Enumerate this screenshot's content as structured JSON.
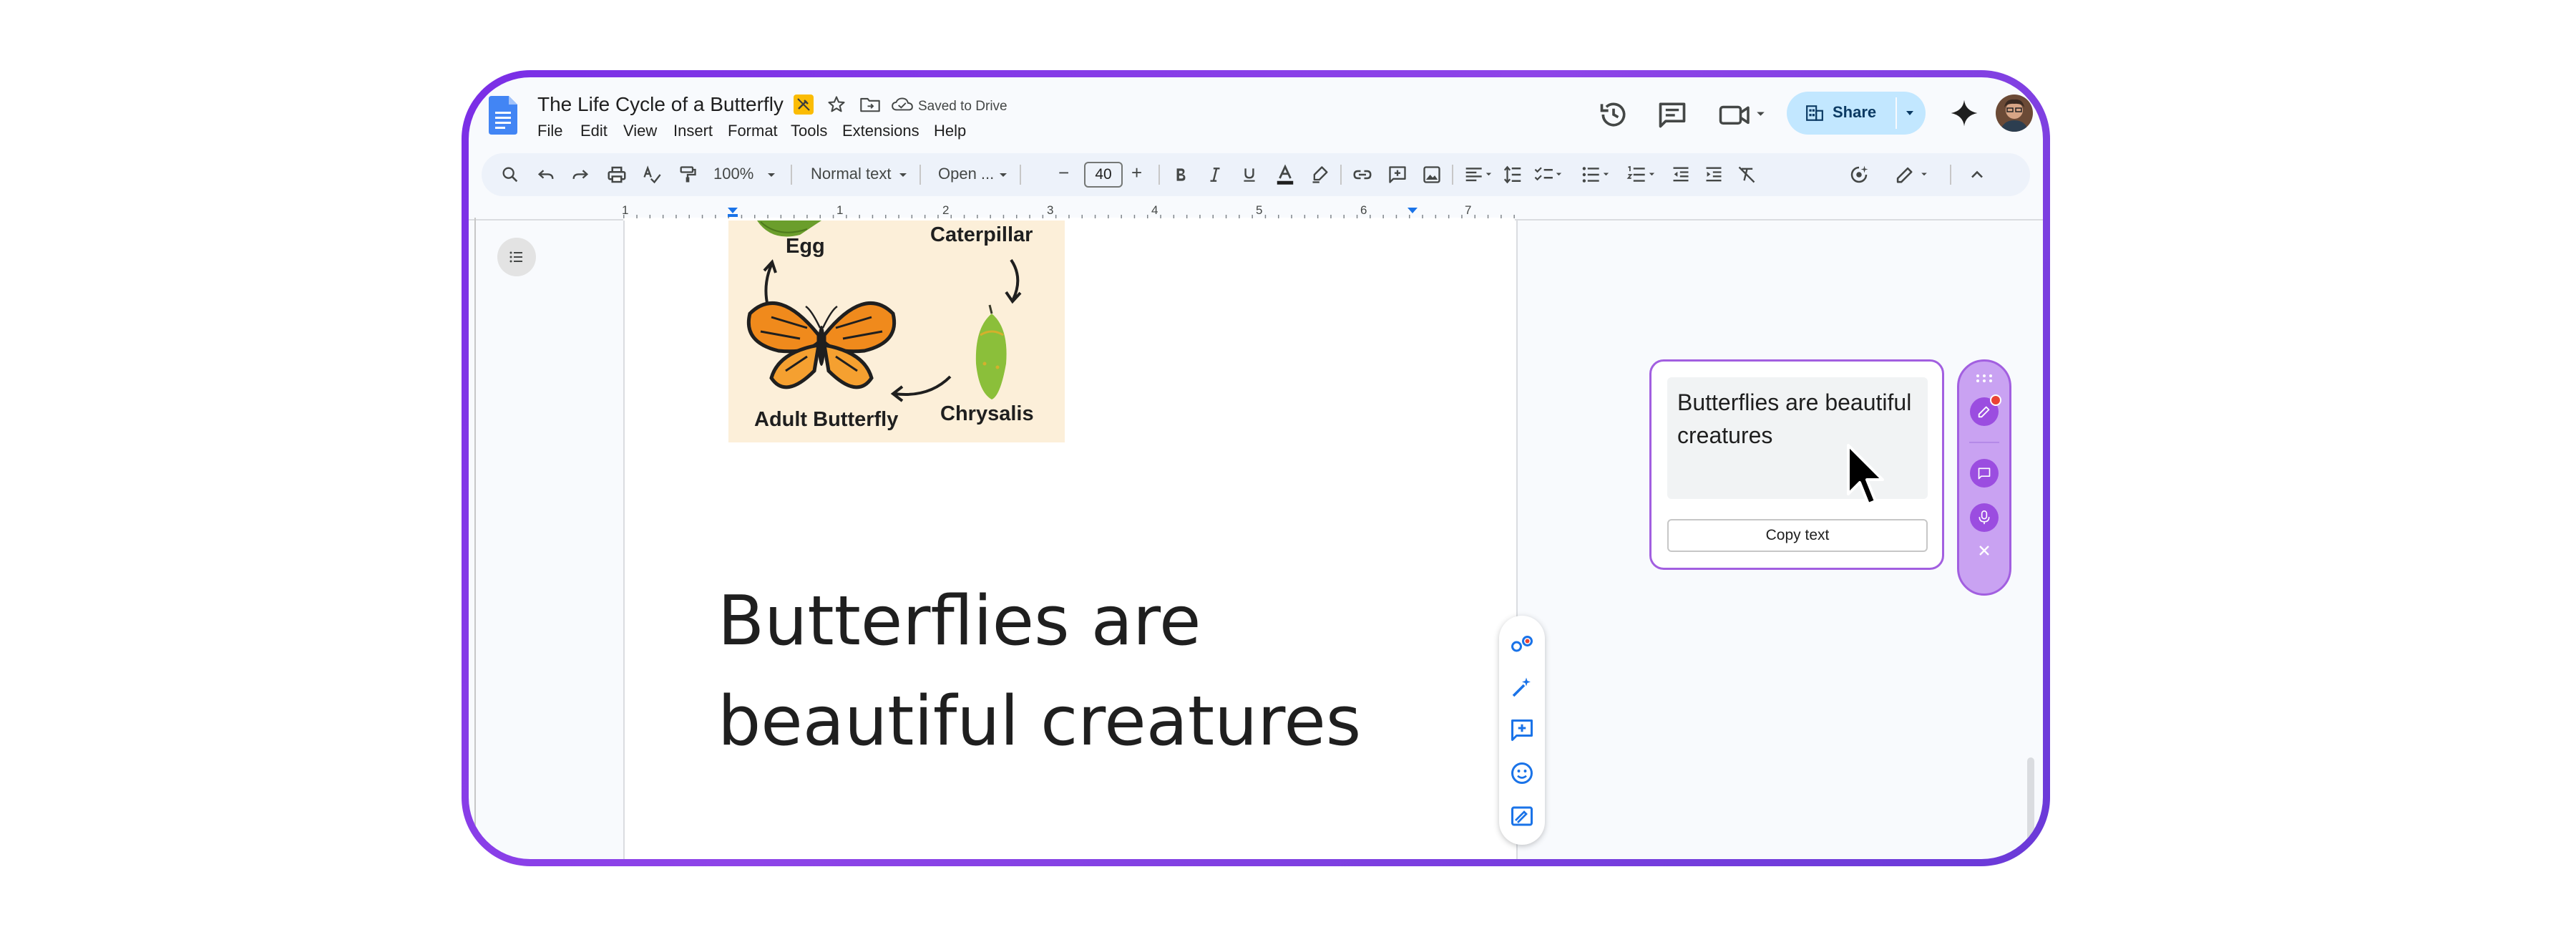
{
  "document": {
    "title": "The Life Cycle of a Butterfly",
    "save_status": "Saved to Drive",
    "heading_line1": "Butterflies are",
    "heading_line2": "beautiful creatures"
  },
  "menu": [
    "File",
    "Edit",
    "View",
    "Insert",
    "Format",
    "Tools",
    "Extensions",
    "Help"
  ],
  "toolbar": {
    "zoom": "100%",
    "style": "Normal text",
    "font": "Open ...",
    "font_size": "40",
    "minus": "−",
    "plus": "+"
  },
  "header": {
    "share_label": "Share"
  },
  "ruler": {
    "numbers": [
      "1",
      "1",
      "2",
      "3",
      "4",
      "5",
      "6",
      "7"
    ]
  },
  "illustration": {
    "labels": [
      "Egg",
      "Caterpillar",
      "Adult Butterfly",
      "Chrysalis"
    ]
  },
  "extension_panel": {
    "text": "Butterflies are beautiful creatures",
    "copy_label": "Copy text"
  },
  "colors": {
    "frame": "#7a2ee6",
    "accent_blue": "#1a73e8",
    "share_bg": "#c2e7ff",
    "extension_purple": "#9b4de0"
  },
  "icons": {
    "header": [
      "version-history-icon",
      "comments-icon",
      "meet-icon",
      "gemini-icon"
    ],
    "toolbar": [
      "search-icon",
      "undo-icon",
      "redo-icon",
      "print-icon",
      "spellcheck-icon",
      "paint-format-icon",
      "bold-icon",
      "italic-icon",
      "underline-icon",
      "text-color-icon",
      "highlight-icon",
      "link-icon",
      "add-comment-icon",
      "insert-image-icon",
      "align-icon",
      "line-spacing-icon",
      "checklist-icon",
      "bulleted-list-icon",
      "numbered-list-icon",
      "decrease-indent-icon",
      "increase-indent-icon",
      "clear-formatting-icon",
      "ai-assist-icon",
      "editing-mode-icon",
      "collapse-icon"
    ],
    "floating": [
      "smart-chips-icon",
      "ai-write-icon",
      "add-comment-icon",
      "emoji-icon",
      "suggest-edits-icon"
    ]
  }
}
